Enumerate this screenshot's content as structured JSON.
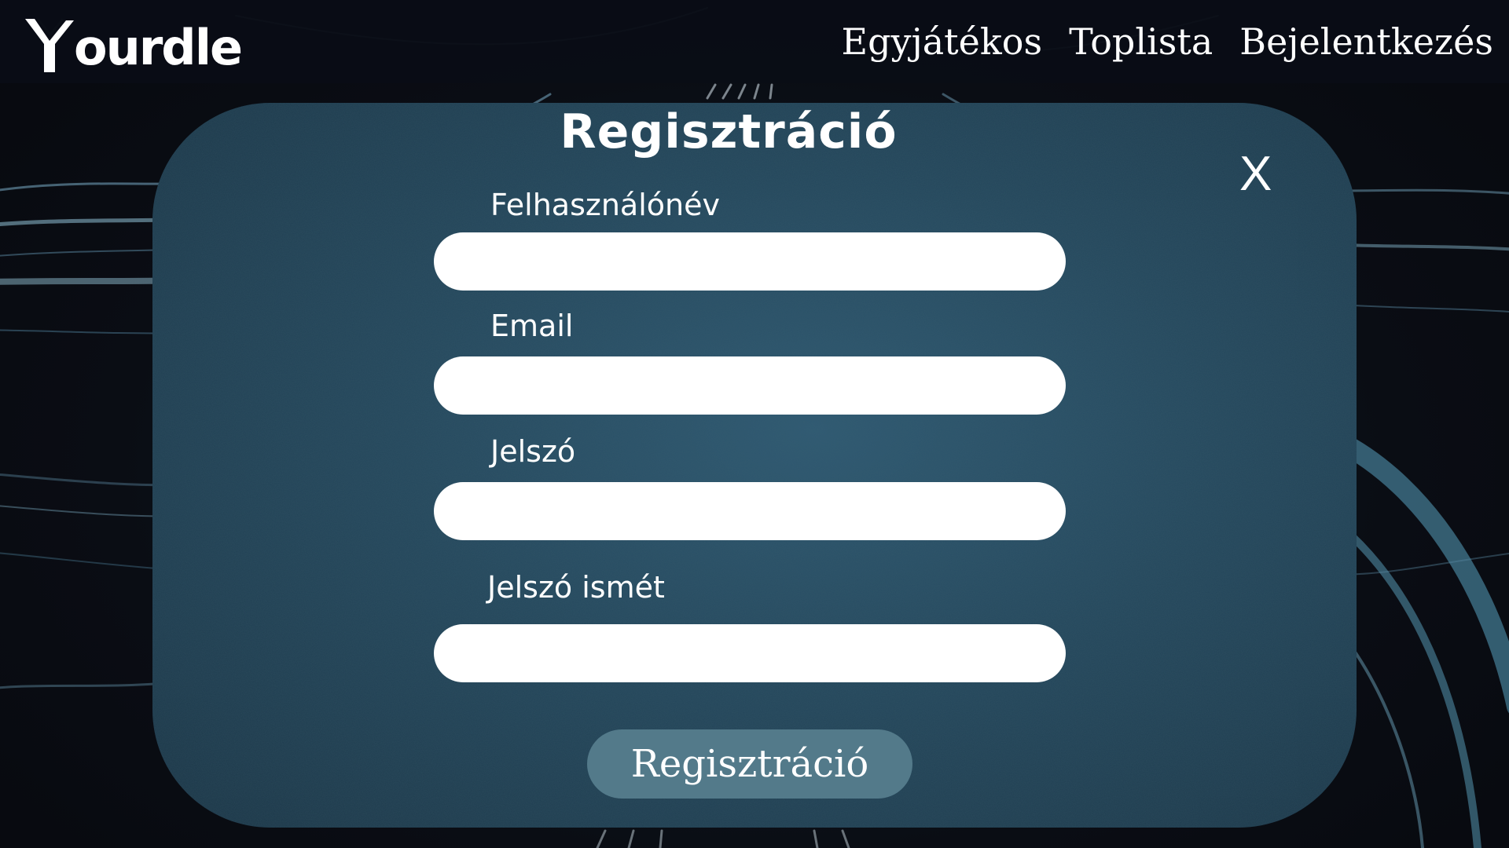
{
  "app": {
    "logo_text": "ourdle",
    "logo_icon": "y-logo-icon"
  },
  "nav": {
    "items": [
      {
        "label": "Egyjátékos"
      },
      {
        "label": "Toplista"
      },
      {
        "label": "Bejelentkezés"
      }
    ]
  },
  "modal": {
    "title": "Regisztráció",
    "close_label": "X",
    "fields": [
      {
        "label": "Felhasználónév",
        "value": "",
        "type": "text"
      },
      {
        "label": "Email",
        "value": "",
        "type": "email"
      },
      {
        "label": "Jelszó",
        "value": "",
        "type": "password"
      },
      {
        "label": "Jelszó ismét",
        "value": "",
        "type": "password"
      }
    ],
    "submit_label": "Regisztráció"
  },
  "colors": {
    "modal_bg": "#2a5066",
    "button_bg": "#537a8a",
    "page_bg": "#0b0f17",
    "text": "#ffffff"
  }
}
